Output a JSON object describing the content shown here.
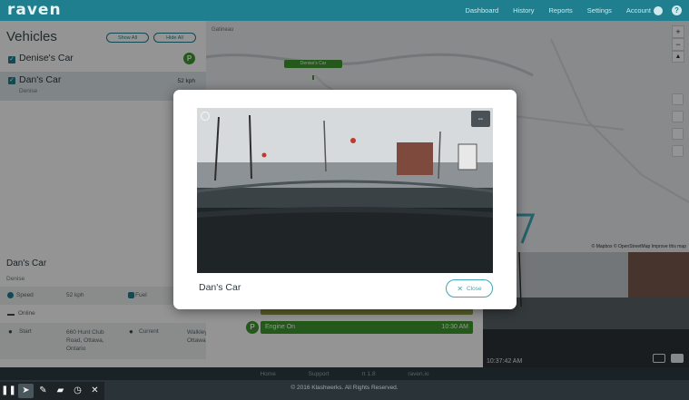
{
  "topbar": {
    "logo": "raven",
    "nav": [
      "Dashboard",
      "History",
      "Reports",
      "Settings",
      "Account"
    ],
    "help": "?"
  },
  "sidebar": {
    "title": "Vehicles",
    "show_all": "Show All",
    "hide_all": "Hide All",
    "vehicles": [
      {
        "name": "Denise's Car",
        "sub": "",
        "badge": "P",
        "speed": ""
      },
      {
        "name": "Dan's Car",
        "sub": "Denise",
        "badge": "",
        "speed": "52 kph"
      }
    ]
  },
  "detail": {
    "title": "Dan's Car",
    "sub": "Denise",
    "speed_label": "Speed",
    "speed_value": "52 kph",
    "fuel_label": "Fuel",
    "online_label": "Online",
    "start_label": "Start",
    "start_value": "660 Hunt Club Road, Ottawa, Ontario",
    "current_label": "Current",
    "current_value": "Walkley Road, Ottawa"
  },
  "map": {
    "labels": [
      "Gatineau",
      "Denise's Car"
    ],
    "zoom_in": "+",
    "zoom_out": "−",
    "compass": "▲",
    "attribution": "© Mapbox © OpenStreetMap Improve this map"
  },
  "timeline": {
    "events": [
      {
        "label": "Engine On",
        "time": "10:30 AM",
        "color": "#3f9a2f"
      }
    ]
  },
  "cam2": {
    "timestamp": "10:37:42 AM"
  },
  "footer": {
    "links": [
      "Home",
      "Support",
      "π 1.8",
      "raven.io"
    ],
    "copyright": "© 2016 Klashwerks. All Rights Reserved."
  },
  "modal": {
    "title": "Dan's Car",
    "close_label": "Close"
  },
  "colors": {
    "brand": "#1f7f8e",
    "accent": "#3fa7b6",
    "parked": "#3f9a2f"
  },
  "icons": [
    "pause-icon",
    "cursor-icon",
    "pen-icon",
    "highlighter-icon",
    "timer-icon",
    "close-icon",
    "expand-icon",
    "record-icon",
    "camera-icon"
  ]
}
